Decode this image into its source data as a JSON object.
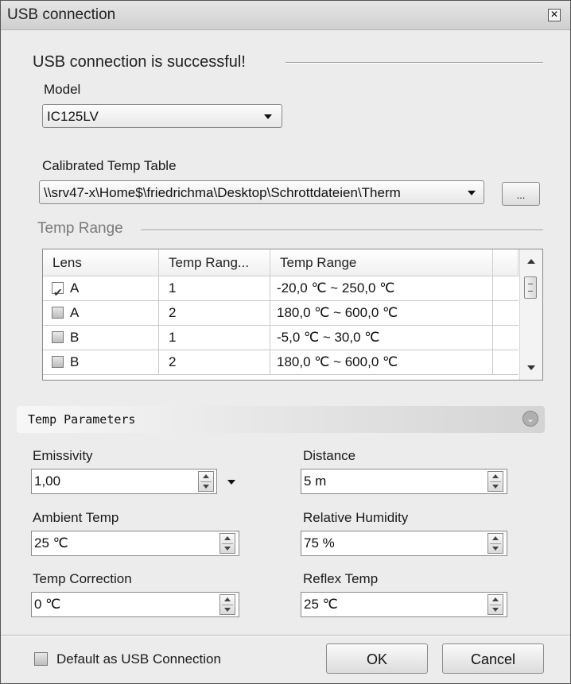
{
  "window": {
    "title": "USB connection",
    "close_icon": "close-icon"
  },
  "status_message": "USB connection is successful!",
  "model": {
    "label": "Model",
    "value": "IC125LV"
  },
  "calibration": {
    "label": "Calibrated Temp Table",
    "value": "\\\\srv47-x\\Home$\\friedrichma\\Desktop\\Schrottdateien\\Therm",
    "browse_label": "..."
  },
  "temp_range": {
    "group_title": "Temp Range",
    "columns": [
      "Lens",
      "Temp Rang...",
      "Temp Range"
    ],
    "rows": [
      {
        "checked": true,
        "lens": "A",
        "index": "1",
        "range": "-20,0 ℃ ~ 250,0 ℃"
      },
      {
        "checked": false,
        "lens": "A",
        "index": "2",
        "range": "180,0 ℃ ~ 600,0 ℃"
      },
      {
        "checked": false,
        "lens": "B",
        "index": "1",
        "range": "-5,0 ℃ ~ 30,0 ℃"
      },
      {
        "checked": false,
        "lens": "B",
        "index": "2",
        "range": "180,0 ℃ ~ 600,0 ℃"
      }
    ]
  },
  "temp_parameters": {
    "title": "Temp Parameters",
    "collapse_icon": "chevron-double-down-icon",
    "emissivity": {
      "label": "Emissivity",
      "value": "1,00"
    },
    "distance": {
      "label": "Distance",
      "value": "5  m"
    },
    "ambient_temp": {
      "label": "Ambient Temp",
      "value": "25 ℃"
    },
    "relative_humidity": {
      "label": "Relative Humidity",
      "value": "75 %"
    },
    "temp_correction": {
      "label": "Temp Correction",
      "value": "0 ℃"
    },
    "reflex_temp": {
      "label": "Reflex Temp",
      "value": "25 ℃"
    }
  },
  "footer": {
    "default_label": "Default as USB Connection",
    "default_checked": false,
    "ok_label": "OK",
    "cancel_label": "Cancel"
  }
}
